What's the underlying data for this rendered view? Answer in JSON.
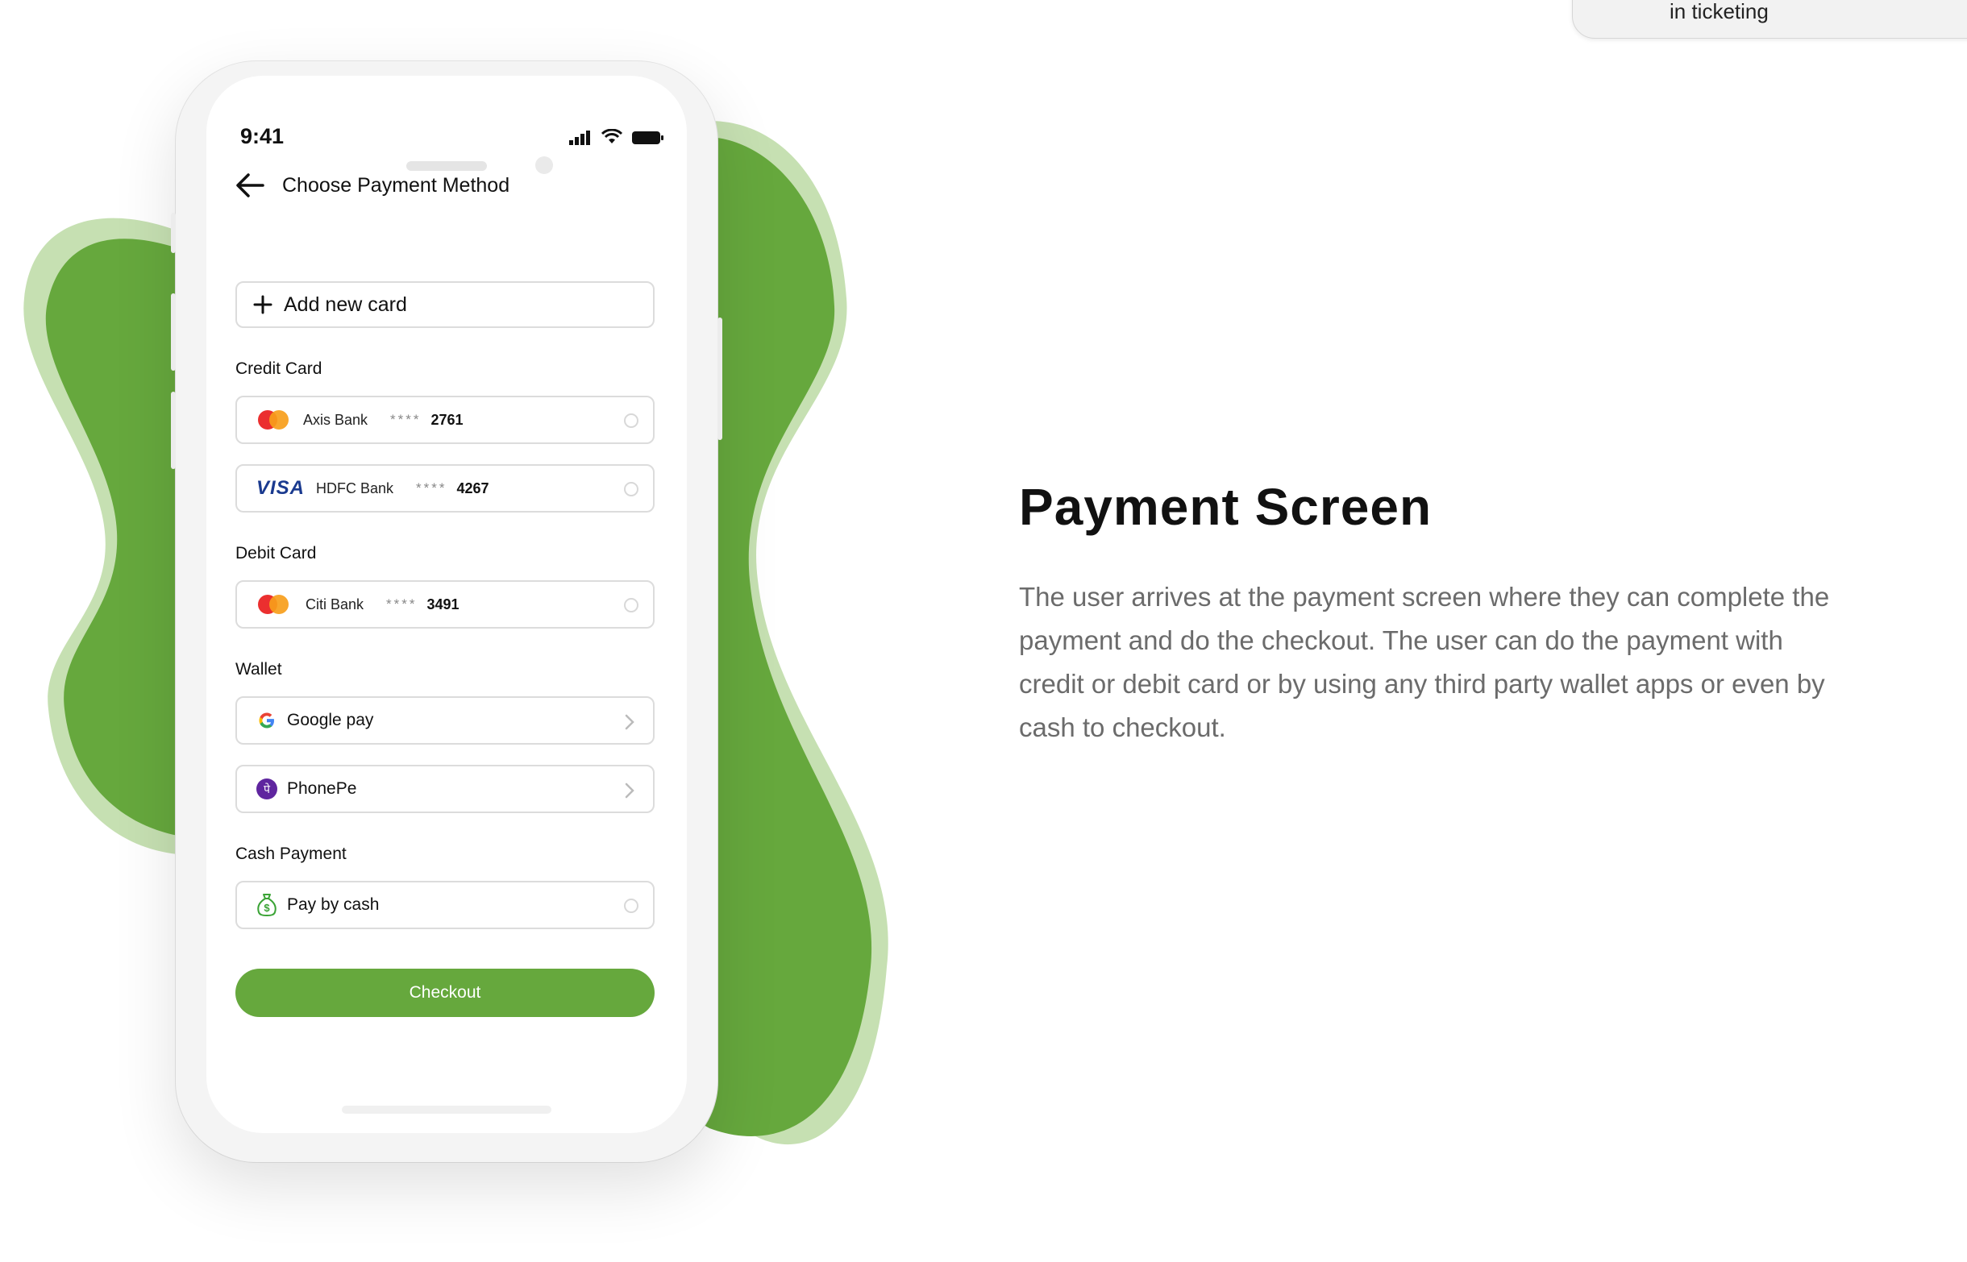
{
  "top_tab": {
    "text": "in ticketing"
  },
  "status_bar": {
    "time": "9:41"
  },
  "header": {
    "title": "Choose Payment Method"
  },
  "add_card": {
    "label": "Add new card"
  },
  "sections": {
    "credit": "Credit Card",
    "debit": "Debit Card",
    "wallet": "Wallet",
    "cash": "Cash Payment"
  },
  "cards": [
    {
      "brand": "mastercard",
      "bank": "Axis Bank",
      "mask": "****",
      "last4": "2761"
    },
    {
      "brand": "visa",
      "brand_text": "VISA",
      "bank": "HDFC Bank",
      "mask": "****",
      "last4": "4267"
    },
    {
      "brand": "mastercard",
      "bank": "Citi Bank",
      "mask": "****",
      "last4": "3491"
    }
  ],
  "wallets": [
    {
      "icon": "google-icon",
      "label": "Google pay"
    },
    {
      "icon": "phonepe-icon",
      "label": "PhonePe",
      "icon_glyph": "पे"
    }
  ],
  "cash": {
    "icon": "money-bag-icon",
    "label": "Pay by cash",
    "icon_glyph": "$"
  },
  "checkout": {
    "label": "Checkout"
  },
  "right_panel": {
    "title": "Payment Screen",
    "description": "The user arrives at the payment screen where they can complete the payment and do the checkout. The user can do the payment with credit or debit card or by using any third party wallet apps or even by cash to checkout."
  },
  "colors": {
    "accent": "#66a83d",
    "blob_light": "#c6e0b2",
    "blob_dark": "#66a83d",
    "visa_blue": "#1a3a8f",
    "phonepe_purple": "#5f259f"
  }
}
